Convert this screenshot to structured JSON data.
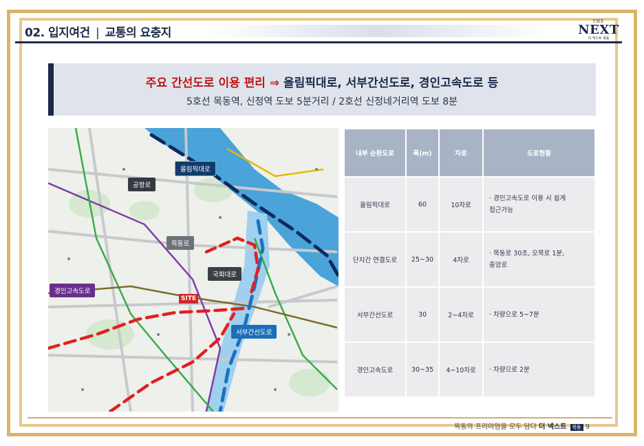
{
  "header": {
    "section": "02. 입지여건",
    "separator": "|",
    "subsection": "교통의 요충지"
  },
  "logo": {
    "small": "THE",
    "main": "NEXT",
    "sub": "더 넥스트 목동"
  },
  "banner": {
    "headline_red": "주요 간선도로 이용 편리 ⇒",
    "headline_navy": "올림픽대로, 서부간선도로, 경인고속도로 등",
    "subline": "5호선 목동역, 신정역 도보 5분거리 / 2호선 신정네거리역 도보 8분"
  },
  "map": {
    "labels": {
      "olympic": "올림픽대로",
      "airport": "공항로",
      "mokdong": "목동로",
      "gukhoe": "국회대로",
      "gyeongin": "경인고속도로",
      "seobu": "서부간선도로",
      "site": "SITE"
    },
    "colors": {
      "river": "#4aa3d9",
      "dashed_red": "#e02020",
      "dashed_navy": "#0e2a5c",
      "dashed_blue": "#1c72c4"
    }
  },
  "table": {
    "headers": [
      "내부 순환도로",
      "폭(m)",
      "차로",
      "도로현황"
    ],
    "rows": [
      {
        "road": "올림픽대로",
        "width": "60",
        "lanes": "10차로",
        "cond1": "· 경인고속도로 이용 시 쉽게",
        "cond2": "접근가능"
      },
      {
        "road": "단지간 연결도로",
        "width": "25~30",
        "lanes": "4차로",
        "cond1": "· 목동로 30초, 오목로 1분,",
        "cond2": "중앙로"
      },
      {
        "road": "서부간선도로",
        "width": "30",
        "lanes": "2~4차로",
        "cond1": "· 차량으로 5~7분",
        "cond2": ""
      },
      {
        "road": "경인고속도로",
        "width": "30~35",
        "lanes": "4~10차로",
        "cond1": "· 차량으로 2분",
        "cond2": ""
      }
    ]
  },
  "footer": {
    "text": "목동의 프리미엄을 모두 담다",
    "brand": "더 넥스트",
    "tag": "목동",
    "page": "9"
  }
}
